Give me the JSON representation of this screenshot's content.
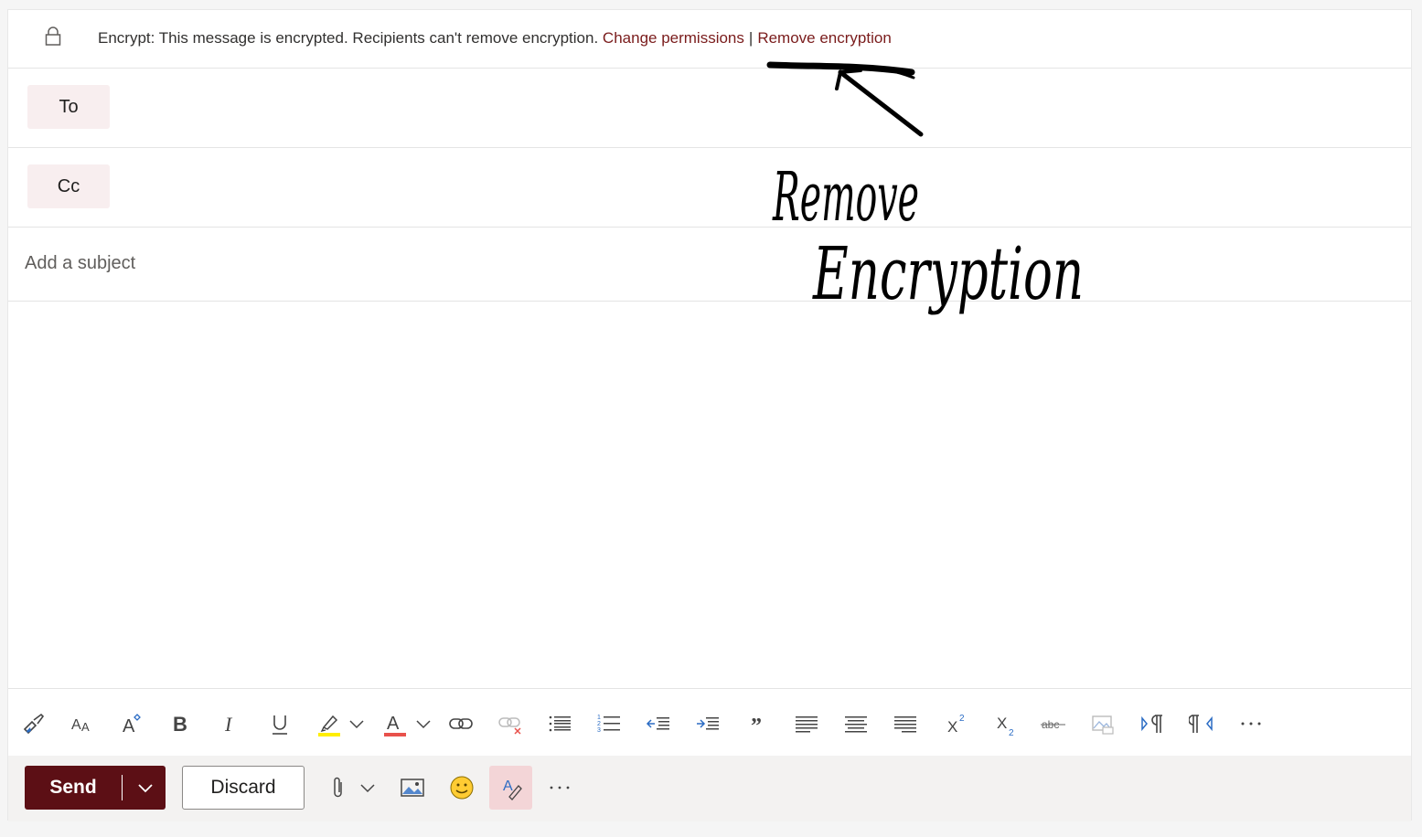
{
  "encryption": {
    "prefix": "Encrypt: This message is encrypted. Recipients can't remove encryption.",
    "change_permissions": "Change permissions",
    "separator": "|",
    "remove_encryption": "Remove encryption"
  },
  "recipients": {
    "to_label": "To",
    "cc_label": "Cc"
  },
  "subject": {
    "placeholder": "Add a subject"
  },
  "annotation": {
    "line1": "Remove",
    "line2": "Encryption"
  },
  "toolbar": {
    "icons": [
      "format-painter-icon",
      "font-size-icon",
      "text-effects-icon",
      "bold-icon",
      "italic-icon",
      "underline-icon",
      "highlight-icon",
      "highlight-dropdown-icon",
      "font-color-icon",
      "font-color-dropdown-icon",
      "insert-link-icon",
      "remove-link-icon",
      "bullets-icon",
      "numbering-icon",
      "decrease-indent-icon",
      "increase-indent-icon",
      "quote-icon",
      "align-left-icon",
      "align-center-icon",
      "align-right-icon",
      "superscript-icon",
      "subscript-icon",
      "strikethrough-icon",
      "picture-icon",
      "ltr-icon",
      "rtl-icon",
      "more-options-icon"
    ]
  },
  "actions": {
    "send_label": "Send",
    "discard_label": "Discard"
  },
  "colors": {
    "accent": "#5c0f15",
    "link": "#7a1c1c",
    "pill_bg": "#f8eeef",
    "highlight_yellow": "#ffee00",
    "font_color_red": "#e8514b",
    "icon_blue": "#2b6cc4"
  }
}
